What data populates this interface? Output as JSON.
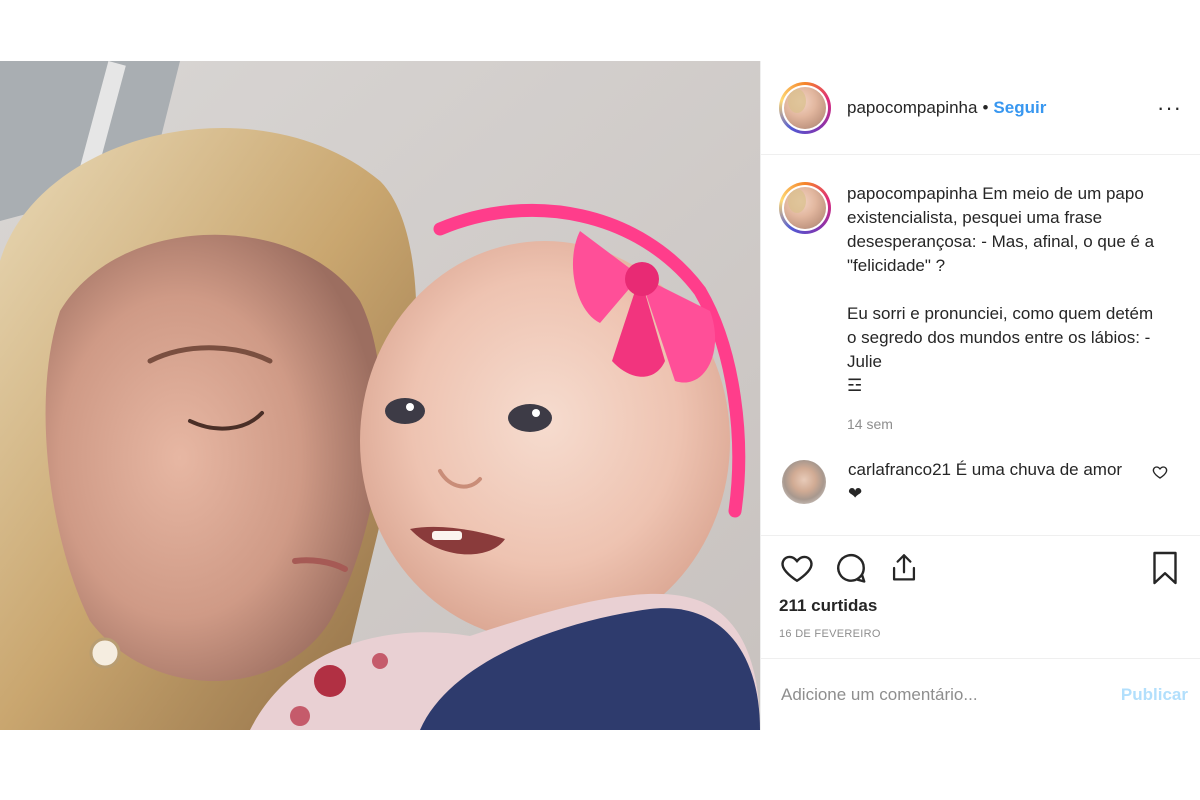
{
  "post": {
    "username": "papocompapinha",
    "separator": "•",
    "follow_label": "Seguir",
    "more_label": "···",
    "caption_user": "papocompapinha",
    "caption_text": "Em meio de um papo existencialista, pesquei uma frase desesperançosa: - Mas, afinal, o que é a \"felicidade\" ?\n\nEu sorri e pronunciei, como quem detém o segredo dos mundos entre os lábios: - Julie\n☲",
    "time_ago": "14 sem",
    "comments": [
      {
        "user": "carlafranco21",
        "text": "É uma chuva de amor ❤"
      }
    ],
    "likes": "211 curtidas",
    "date": "16 DE FEVEREIRO",
    "comment_placeholder": "Adicione um comentário...",
    "publish_label": "Publicar"
  },
  "icons": {
    "avatar": "profile-photo",
    "more": "more-options-icon",
    "like": "heart-outline-icon",
    "comment": "speech-bubble-icon",
    "share": "share-upload-icon",
    "save": "bookmark-icon",
    "comment_like": "small-heart-icon"
  },
  "colors": {
    "follow": "#3897f0",
    "publish_disabled": "#b2dffc",
    "muted": "#8e8e8e",
    "text": "#262626",
    "headband": "#ff3d8b"
  }
}
